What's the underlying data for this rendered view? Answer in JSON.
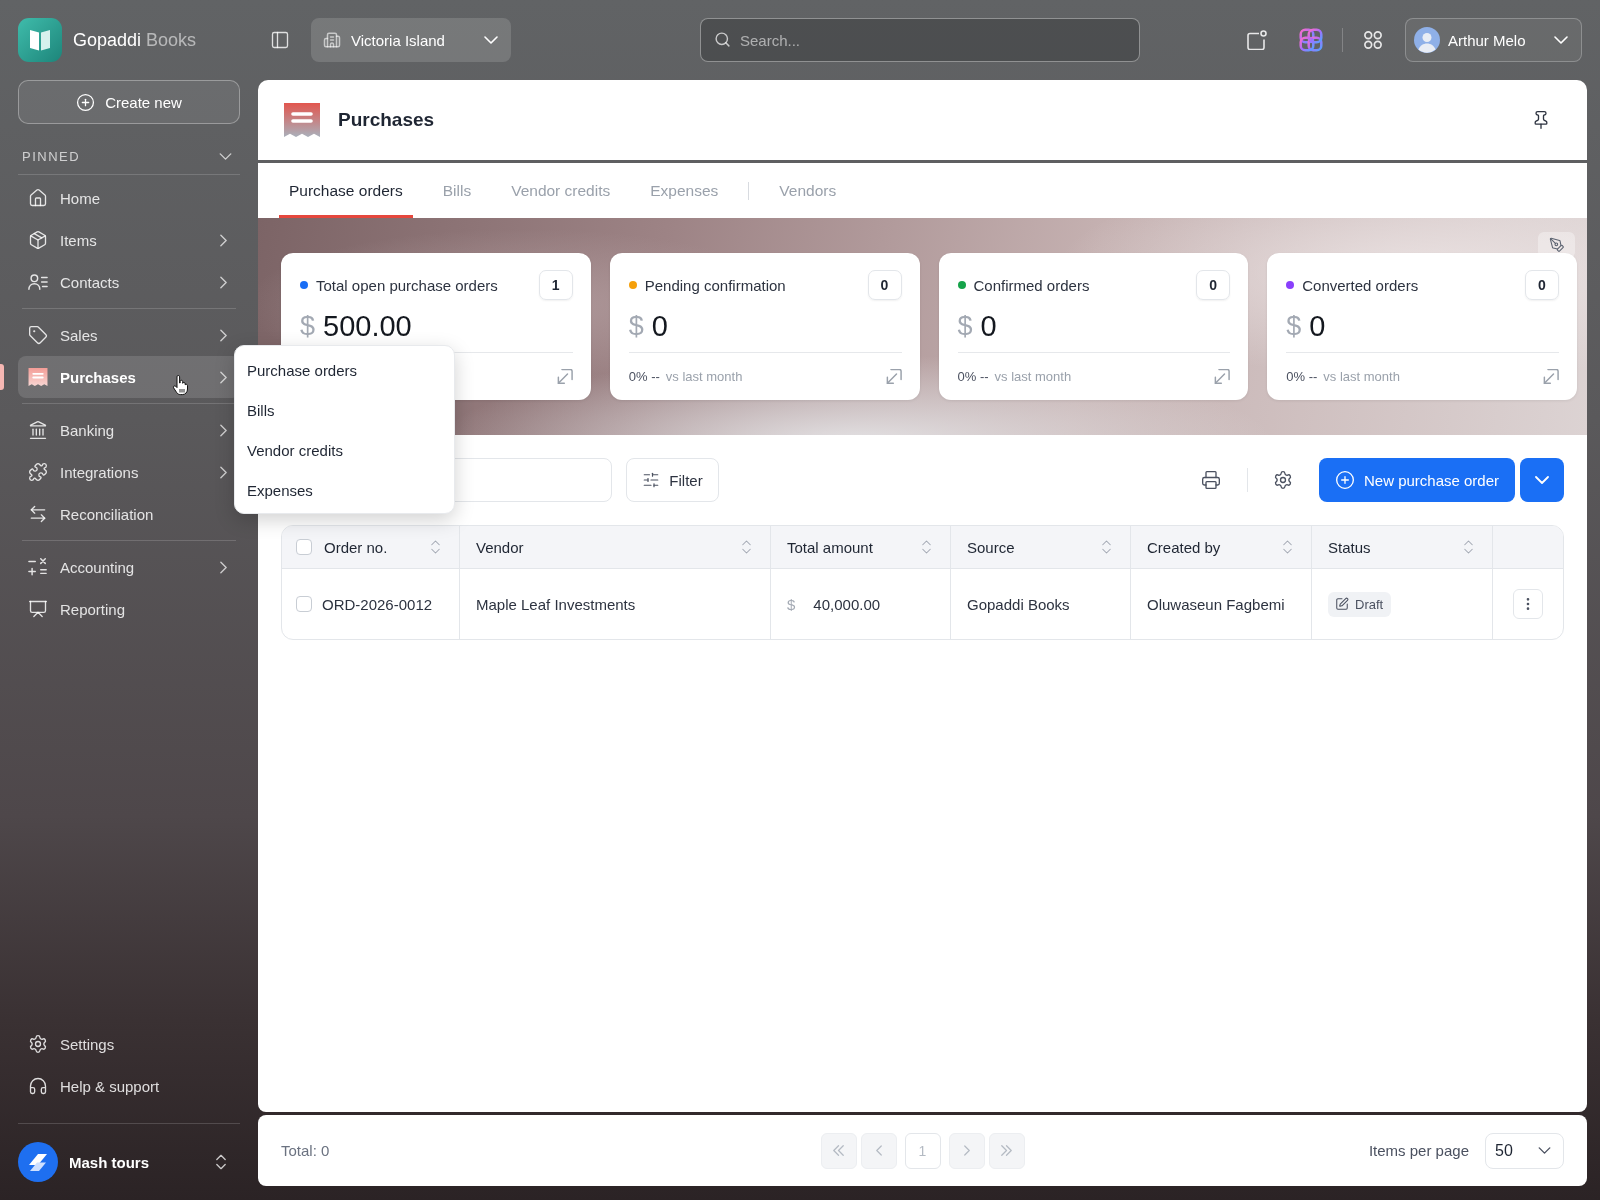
{
  "app": {
    "name": "Gopaddi",
    "suffix": "Books"
  },
  "topbar": {
    "location": "Victoria Island",
    "search_placeholder": "Search...",
    "user_name": "Arthur Melo"
  },
  "sidebar": {
    "create_button": "Create new",
    "section": {
      "label": "PINNED",
      "expanded": true
    },
    "groups": [
      {
        "items": [
          {
            "label": "Home",
            "submenu": false,
            "selected": false
          },
          {
            "label": "Items",
            "submenu": true,
            "selected": false
          },
          {
            "label": "Contacts",
            "submenu": true,
            "selected": false
          }
        ]
      },
      {
        "items": [
          {
            "label": "Sales",
            "submenu": true,
            "selected": false
          },
          {
            "label": "Purchases",
            "submenu": true,
            "selected": true
          }
        ]
      },
      {
        "items": [
          {
            "label": "Banking",
            "submenu": true,
            "selected": false
          },
          {
            "label": "Integrations",
            "submenu": true,
            "selected": false
          },
          {
            "label": "Reconciliation",
            "submenu": false,
            "selected": false
          }
        ]
      },
      {
        "items": [
          {
            "label": "Accounting",
            "submenu": true,
            "selected": false
          },
          {
            "label": "Reporting",
            "submenu": false,
            "selected": false
          }
        ]
      }
    ],
    "footer_items": [
      {
        "label": "Settings"
      },
      {
        "label": "Help & support"
      }
    ],
    "workspace": "Mash tours"
  },
  "flyout_menu": [
    {
      "label": "Purchase orders"
    },
    {
      "label": "Bills"
    },
    {
      "label": "Vendor credits"
    },
    {
      "label": "Expenses"
    }
  ],
  "page": {
    "title": "Purchases"
  },
  "tabs": [
    {
      "label": "Purchase orders",
      "selected": true,
      "divider_before": false
    },
    {
      "label": "Bills",
      "selected": false,
      "divider_before": false
    },
    {
      "label": "Vendor credits",
      "selected": false,
      "divider_before": false
    },
    {
      "label": "Expenses",
      "selected": false,
      "divider_before": false
    },
    {
      "label": "Vendors",
      "selected": false,
      "divider_before": true
    }
  ],
  "stats": [
    {
      "label": "Total open purchase orders",
      "color": "#1a6ef5",
      "count": "1",
      "currency": "$",
      "amount": "500.00"
    },
    {
      "label": "Pending confirmation",
      "color": "#f5a00b",
      "count": "0",
      "currency": "$",
      "amount": "0",
      "change": "0% --",
      "comparison": "vs last month"
    },
    {
      "label": "Confirmed orders",
      "color": "#16a34a",
      "count": "0",
      "currency": "$",
      "amount": "0",
      "change": "0% --",
      "comparison": "vs last month"
    },
    {
      "label": "Converted orders",
      "color": "#8a3ffc",
      "count": "0",
      "currency": "$",
      "amount": "0",
      "change": "0% --",
      "comparison": "vs last month"
    }
  ],
  "toolbar": {
    "filter": "Filter",
    "new_button": "New purchase order"
  },
  "table": {
    "all_checked": false,
    "columns": [
      "Order no.",
      "Vendor",
      "Total amount",
      "Source",
      "Created by",
      "Status"
    ],
    "rows": [
      {
        "checked": false,
        "order_no": "ORD-2026-0012",
        "vendor": "Maple Leaf Investments",
        "currency": "$",
        "total": "40,000.00",
        "source": "Gopaddi Books",
        "created_by": "Oluwaseun Fagbemi",
        "status": {
          "kind": "draft",
          "label": "Draft"
        }
      }
    ]
  },
  "footer": {
    "total": "Total: 0",
    "pagination": [
      {
        "kind": "first",
        "disabled": true
      },
      {
        "kind": "previous",
        "disabled": true
      },
      {
        "kind": "page",
        "label": "1",
        "disabled": true
      },
      {
        "kind": "next",
        "disabled": true
      },
      {
        "kind": "last",
        "disabled": true
      }
    ],
    "per_page_label": "Items per page",
    "per_page": "50"
  }
}
